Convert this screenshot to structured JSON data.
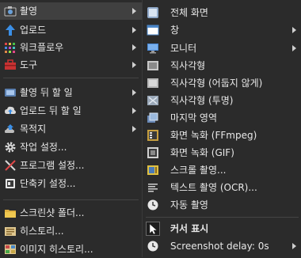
{
  "left_menu": [
    {
      "label": "촬영",
      "icon": "camera-icon"
    },
    {
      "label": "업로드",
      "icon": "upload-arrow-icon"
    },
    {
      "label": "워크플로우",
      "icon": "workflow-grid-icon"
    },
    {
      "label": "도구",
      "icon": "toolbox-icon"
    },
    {
      "label": "촬영 뒤 할 일",
      "icon": "after-capture-icon"
    },
    {
      "label": "업로드 뒤 할 일",
      "icon": "after-upload-icon"
    },
    {
      "label": "목적지",
      "icon": "destination-icon"
    },
    {
      "label": "작업 설정...",
      "icon": "gear-icon"
    },
    {
      "label": "프로그램 설정...",
      "icon": "tools-icon"
    },
    {
      "label": "단축키 설정...",
      "icon": "keyboard-icon"
    },
    {
      "label": "스크린샷 폴더...",
      "icon": "folder-icon"
    },
    {
      "label": "히스토리...",
      "icon": "history-icon"
    },
    {
      "label": "이미지 히스토리...",
      "icon": "image-history-icon"
    }
  ],
  "right_menu": [
    {
      "label": "전체 화면",
      "icon": "fullscreen-icon"
    },
    {
      "label": "창",
      "icon": "window-icon"
    },
    {
      "label": "모니터",
      "icon": "monitor-icon"
    },
    {
      "label": "직사각형",
      "icon": "rectangle-icon"
    },
    {
      "label": "직사각형 (어둡지 않게)",
      "icon": "rectangle-light-icon"
    },
    {
      "label": "직사각형 (투명)",
      "icon": "rectangle-transparent-icon"
    },
    {
      "label": "마지막 영역",
      "icon": "last-region-icon"
    },
    {
      "label": "화면 녹화 (FFmpeg)",
      "icon": "screen-record-ffmpeg-icon"
    },
    {
      "label": "화면 녹화 (GIF)",
      "icon": "screen-record-gif-icon"
    },
    {
      "label": "스크롤 촬영...",
      "icon": "scrolling-capture-icon"
    },
    {
      "label": "텍스트 촬영 (OCR)...",
      "icon": "ocr-icon"
    },
    {
      "label": "자동 촬영",
      "icon": "clock-icon"
    },
    {
      "label": "커서 표시",
      "icon": "cursor-icon"
    },
    {
      "label": "Screenshot delay: 0s",
      "icon": "delay-clock-icon"
    }
  ]
}
